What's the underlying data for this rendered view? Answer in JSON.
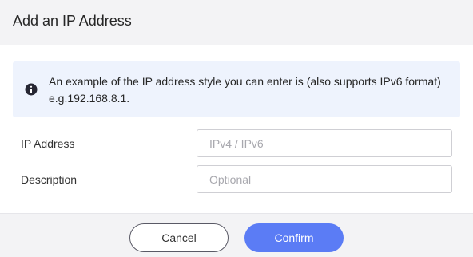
{
  "dialog": {
    "title": "Add an IP Address"
  },
  "info": {
    "icon": "info-circle-icon",
    "line1": "An example of the IP address style you can enter is (also supports IPv6 format)",
    "line2": "e.g.192.168.8.1."
  },
  "form": {
    "ip_address": {
      "label": "IP Address",
      "value": "",
      "placeholder": "IPv4 / IPv6"
    },
    "description": {
      "label": "Description",
      "value": "",
      "placeholder": "Optional"
    }
  },
  "footer": {
    "cancel_label": "Cancel",
    "confirm_label": "Confirm"
  },
  "colors": {
    "accent": "#5b7cf5",
    "info_background": "#eef3fd",
    "header_background": "#f3f3f5"
  }
}
